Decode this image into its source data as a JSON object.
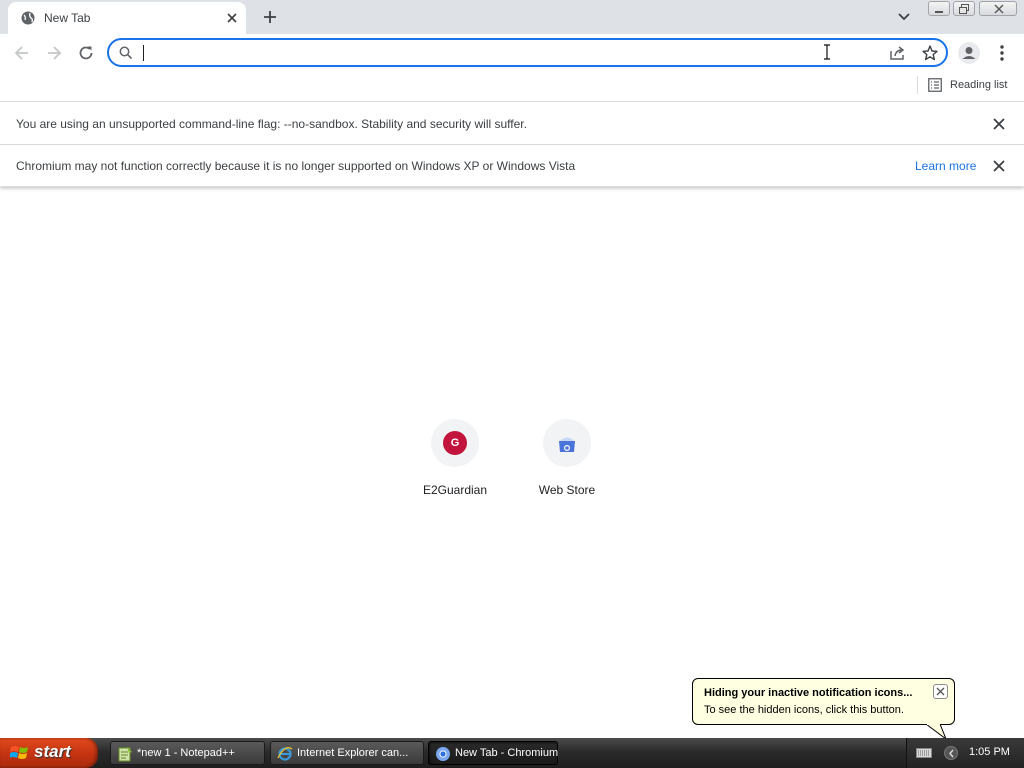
{
  "browser": {
    "tab": {
      "title": "New Tab"
    },
    "toolbar": {
      "omnibox_value": ""
    },
    "bookmarks_bar": {
      "reading_list": "Reading list"
    },
    "infobars": [
      {
        "message": "You are using an unsupported command-line flag: --no-sandbox. Stability and security will suffer."
      },
      {
        "message": "Chromium may not function correctly because it is no longer supported on Windows XP or Windows Vista",
        "link": "Learn more"
      }
    ],
    "shortcuts": [
      {
        "label": "E2Guardian",
        "letter": "G",
        "color": "#c2143c"
      },
      {
        "label": "Web Store"
      }
    ]
  },
  "balloon": {
    "title": "Hiding your inactive notification icons...",
    "text": "To see the hidden icons, click this button."
  },
  "taskbar": {
    "start_label": "start",
    "tasks": [
      {
        "label": "*new 1 - Notepad++",
        "icon": "notepad-icon"
      },
      {
        "label": "Internet Explorer can...",
        "icon": "ie-icon"
      },
      {
        "label": "New Tab - Chromium",
        "icon": "chromium-icon",
        "active": true
      }
    ],
    "clock": "1:05 PM"
  },
  "colors": {
    "accent": "#1a73e8",
    "tabstrip": "#dee1e6",
    "start": "#c33311",
    "balloon": "#ffffe1"
  }
}
